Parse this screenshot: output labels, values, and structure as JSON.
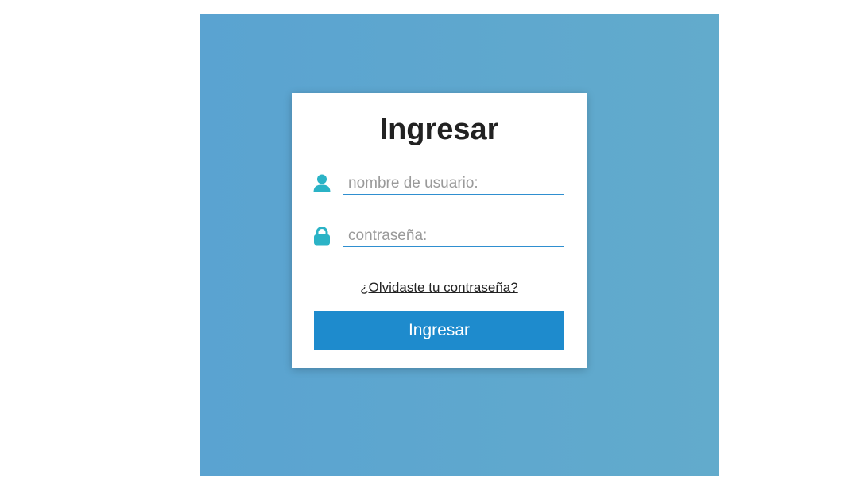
{
  "login": {
    "title": "Ingresar",
    "username_placeholder": "nombre de usuario:",
    "password_placeholder": "contraseña:",
    "forgot_link": "¿Olvidaste tu contraseña?",
    "submit_label": "Ingresar"
  },
  "icons": {
    "username": "user-icon",
    "password": "lock-icon"
  },
  "colors": {
    "background": "#5da7cf",
    "icon_accent": "#2bb3c6",
    "button": "#1e8bcd",
    "input_underline": "#2f8fd0"
  }
}
